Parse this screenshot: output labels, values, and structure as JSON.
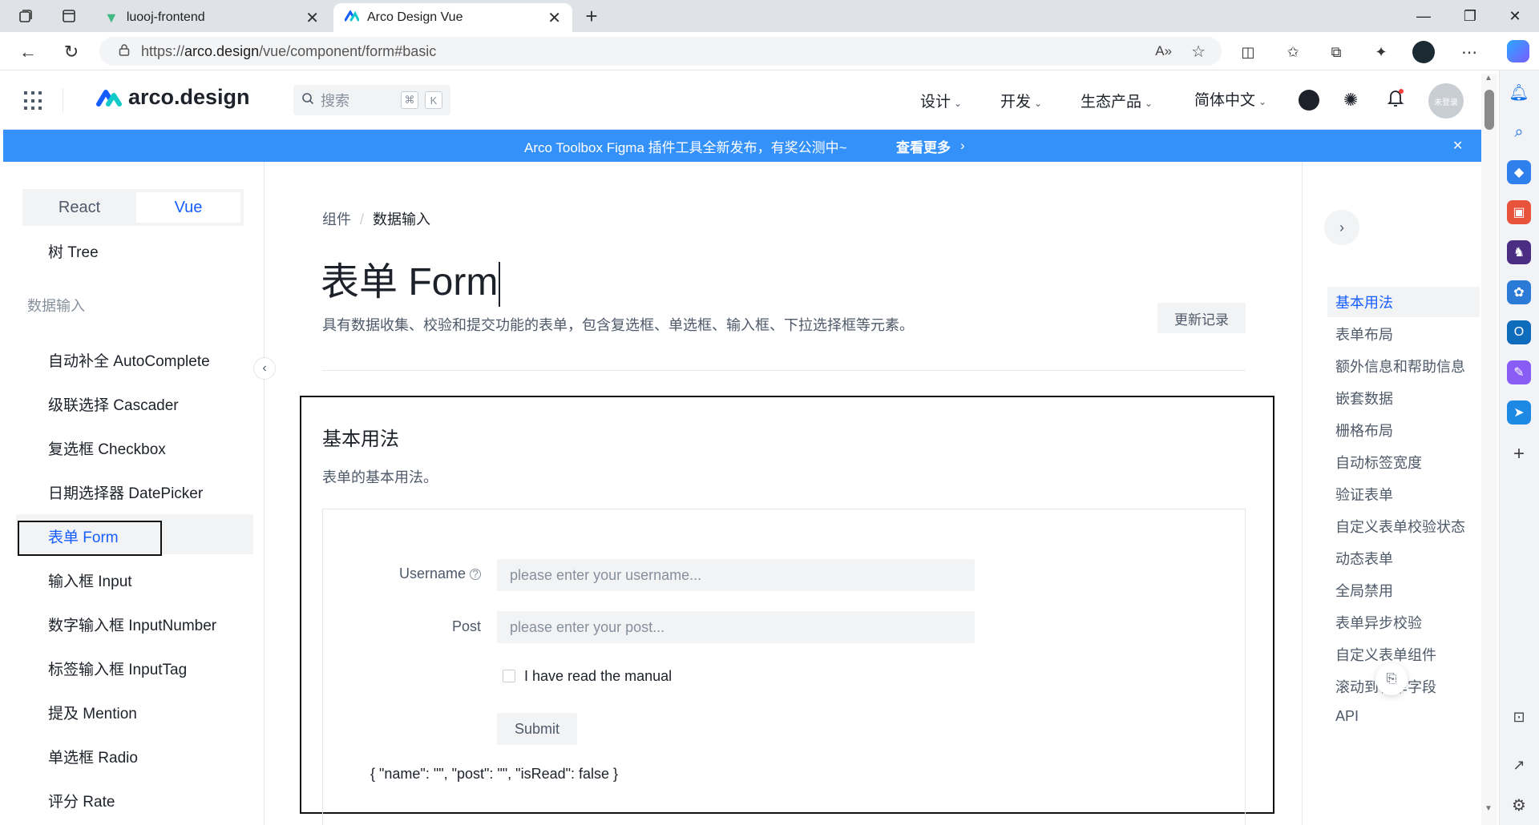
{
  "browser": {
    "tabs": [
      {
        "title": "luooj-frontend"
      },
      {
        "title": "Arco Design Vue"
      }
    ],
    "url_prefix": "https://",
    "url_host": "arco.design",
    "url_path": "/vue/component/form#basic"
  },
  "site": {
    "logo_text": "arco.design",
    "search_placeholder": "搜索",
    "search_kbd1": "⌘",
    "search_kbd2": "K",
    "menu": [
      "设计",
      "开发",
      "生态产品",
      "简体中文"
    ],
    "avatar_text": "未登录"
  },
  "banner": {
    "text": "Arco Toolbox Figma 插件工具全新发布，有奖公测中~",
    "link": "查看更多"
  },
  "leftnav": {
    "switch": [
      "React",
      "Vue"
    ],
    "top_item": "树 Tree",
    "group": "数据输入",
    "items": [
      "自动补全 AutoComplete",
      "级联选择 Cascader",
      "复选框 Checkbox",
      "日期选择器 DatePicker",
      "表单 Form",
      "输入框 Input",
      "数字输入框 InputNumber",
      "标签输入框 InputTag",
      "提及 Mention",
      "单选框 Radio",
      "评分 Rate"
    ]
  },
  "content": {
    "breadcrumb": [
      "组件",
      "数据输入"
    ],
    "title": "表单 Form",
    "description": "具有数据收集、校验和提交功能的表单，包含复选框、单选框、输入框、下拉选择框等元素。",
    "changelog": "更新记录",
    "section_title": "基本用法",
    "section_desc": "表单的基本用法。",
    "form": {
      "username_label": "Username",
      "username_placeholder": "please enter your username...",
      "post_label": "Post",
      "post_placeholder": "please enter your post...",
      "checkbox_label": "I have read the manual",
      "submit": "Submit",
      "json_output": "{ \"name\": \"\", \"post\": \"\", \"isRead\": false }"
    }
  },
  "toc": [
    "基本用法",
    "表单布局",
    "额外信息和帮助信息",
    "嵌套数据",
    "栅格布局",
    "自动标签宽度",
    "验证表单",
    "自定义表单校验状态",
    "动态表单",
    "全局禁用",
    "表单异步校验",
    "自定义表单组件",
    "滚动到表单字段",
    "API"
  ],
  "colors": {
    "accent": "#165dff",
    "banner": "#3491fa"
  }
}
